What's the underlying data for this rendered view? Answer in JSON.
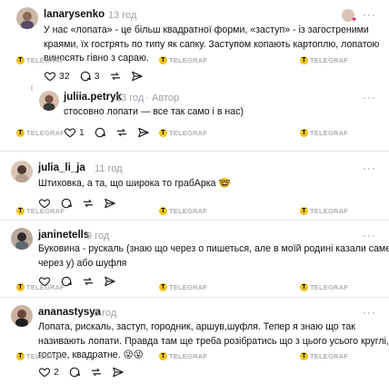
{
  "watermark": "TELEGRAF",
  "watermark_icon": "T",
  "colors": {
    "accent_gold": "#f2c218",
    "heart_red": "#e0245e",
    "muted": "#9aa0a6"
  },
  "comments": [
    {
      "username": "lanarysenko",
      "time": "13 год",
      "lines": [
        "У нас «лопата» - це більш квадратної форми, «заступ» - із загостреними",
        "краями, їх гострять по типу як сапку. Заступом копають картоплю, лопатою",
        "виносять гівно з сараю."
      ],
      "likes": "32",
      "replies": "3",
      "more": "···"
    },
    {
      "username": "juliia.petryk",
      "time": "13 год",
      "badge": "Автор",
      "lines": [
        "стосовно лопати — все так само і в нас)"
      ],
      "likes": "1",
      "more": "···"
    },
    {
      "username": "julia_li_ja",
      "time": "11 год",
      "lines": [
        "Штиховка, а та, що широка то грабАрка 🤓"
      ],
      "more": "···"
    },
    {
      "username": "janinetells",
      "time": "9 год",
      "lines": [
        "Буковина - рускаль (знаю що через о пишеться, але в моїй родині казали саме",
        "через у) або шуфля"
      ],
      "more": "···"
    },
    {
      "username": "ananastysya",
      "time": "8 год",
      "lines": [
        "Лопата, рискаль, заступ, городник, аршув,шуфля. Тепер я знаю що так",
        "називають лопати. Правда там ще треба розібратись що з цього усього круглі,",
        "гостре, квадратне. 😜😜"
      ],
      "likes": "2",
      "more": "···"
    }
  ]
}
